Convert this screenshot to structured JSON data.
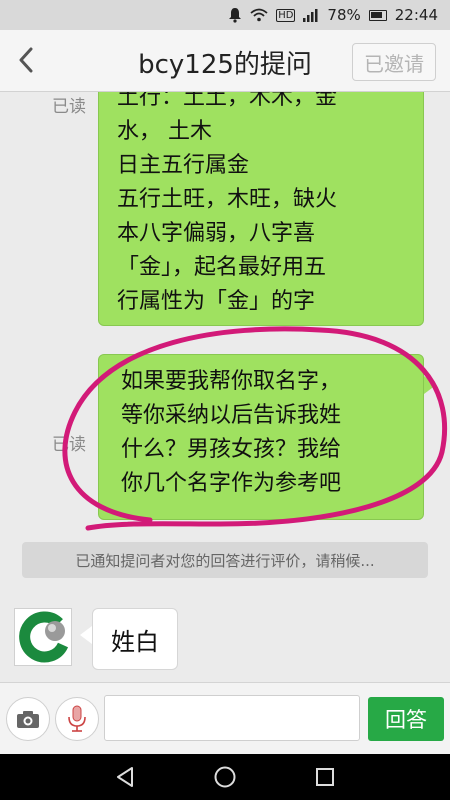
{
  "status_bar": {
    "hd": "HD",
    "battery": "78%",
    "time": "22:44"
  },
  "header": {
    "title": "bcy125的提问",
    "invite_label": "已邀请"
  },
  "messages": {
    "read1": "已读",
    "bubble1_lines": [
      "土行：土土，木木，金",
      "水， 土木",
      "日主五行属金",
      "五行土旺，木旺，缺火",
      "本八字偏弱，八字喜",
      "「金」，起名最好用五",
      "行属性为「金」的字"
    ],
    "read2": "已读",
    "bubble2_lines": [
      "如果要我帮你取名字，",
      "等你采纳以后告诉我姓",
      "什么？男孩女孩？我给",
      "你几个名字作为参考吧"
    ],
    "notice": "已通知提问者对您的回答进行评价，请稍候...",
    "incoming": "姓白"
  },
  "input_bar": {
    "placeholder": "",
    "answer_label": "回答"
  },
  "icons": {
    "back": "chevron-left-icon",
    "camera": "camera-icon",
    "mic": "microphone-icon",
    "nav_back": "triangle-back-icon",
    "nav_home": "circle-home-icon",
    "nav_recent": "square-recent-icon"
  },
  "colors": {
    "bubble_green": "#9fe160",
    "answer_green": "#27a946",
    "annotation_pink": "#d21a78"
  }
}
